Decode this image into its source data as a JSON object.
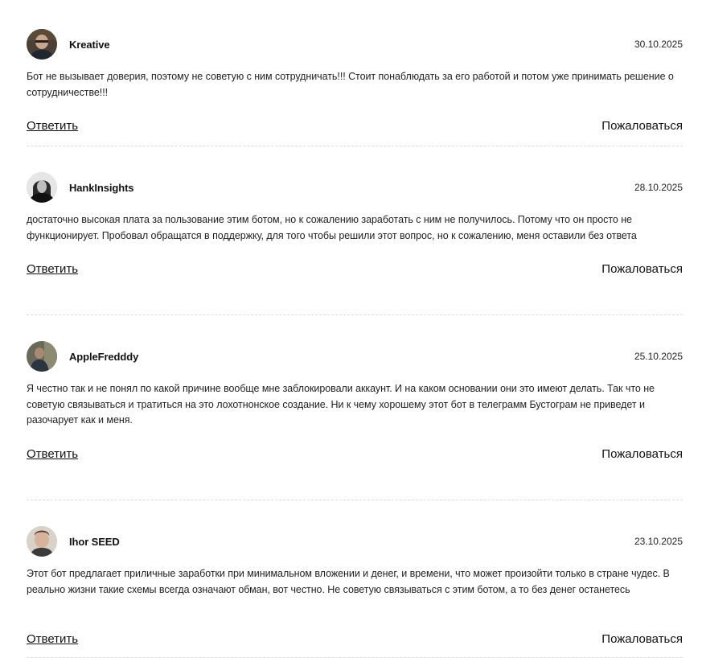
{
  "comments": [
    {
      "author": "Kreative",
      "date": "30.10.2025",
      "text": "Бот не вызывает доверия, поэтому не советую с ним сотрудничать!!! Стоит понаблюдать за его работой и потом уже принимать решение о сотрудничестве!!!",
      "reply_label": "Ответить",
      "report_label": "Пожаловаться",
      "avatar": "user-photo-icon"
    },
    {
      "author": "HankInsights",
      "date": "28.10.2025",
      "text": "достаточно высокая плата за пользование этим ботом, но к сожалению заработать с ним не получилось. Потому что он просто не функционирует. Пробовал обращатся в поддержку, для того чтобы решили этот вопрос, но к сожалению, меня оставили без ответа",
      "reply_label": "Ответить",
      "report_label": "Пожаловаться",
      "avatar": "user-photo-icon"
    },
    {
      "author": "AppleFredddy",
      "date": "25.10.2025",
      "text": "Я честно так и не понял по какой причине вообще мне заблокировали аккаунт. И на каком основании они это имеют делать. Так что не советую связываться и тратиться на это лохотнонское создание. Ни к чему хорошему этот бот в телеграмм Бустограм не приведет и разочарует как и меня.",
      "reply_label": "Ответить",
      "report_label": "Пожаловаться",
      "avatar": "user-photo-icon"
    },
    {
      "author": "Ihor SEED",
      "date": "23.10.2025",
      "text": "Этот бот предлагает приличные заработки при минимальном вложении и денег, и времени, что может произойти только в стране чудес. В реально жизни такие схемы всегда означают обман, вот честно. Не советую связываться с этим ботом, а то без денег останетесь",
      "reply_label": "Ответить",
      "report_label": "Пожаловаться",
      "avatar": "user-photo-icon"
    }
  ]
}
